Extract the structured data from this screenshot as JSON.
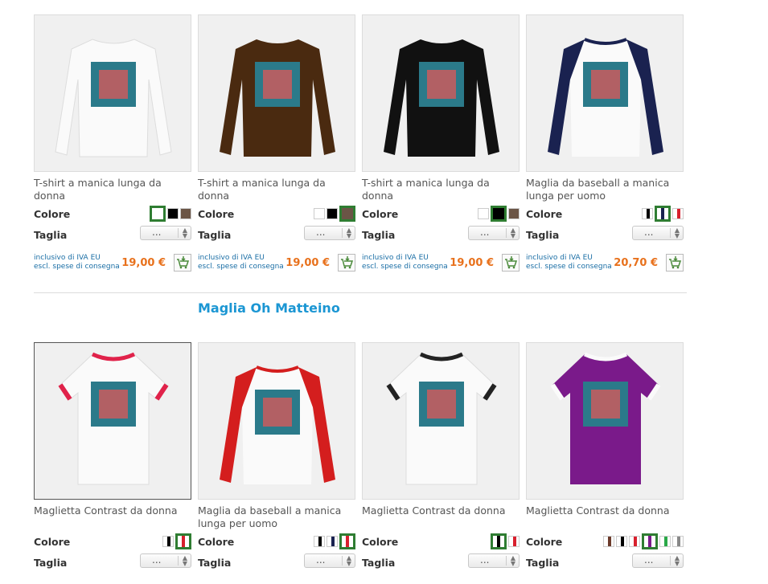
{
  "labels": {
    "colore": "Colore",
    "taglia": "Taglia",
    "vat_line1": "inclusivo di IVA EU",
    "vat_line2": "escl. spese di consegna"
  },
  "section_title": "Maglia Oh Matteino",
  "size_placeholder": "...",
  "products_row1": [
    {
      "name": "T-shirt a manica lunga da donna",
      "price": "19,00 €"
    },
    {
      "name": "T-shirt a manica lunga da donna",
      "price": "19,00 €"
    },
    {
      "name": "T-shirt a manica lunga da donna",
      "price": "19,00 €"
    },
    {
      "name": "Maglia da baseball a manica lunga per uomo",
      "price": "20,70 €"
    }
  ],
  "products_row2": [
    {
      "name": "Maglietta Contrast da donna"
    },
    {
      "name": "Maglia da baseball a manica lunga per uomo"
    },
    {
      "name": "Maglietta Contrast da donna"
    },
    {
      "name": "Maglietta Contrast da donna"
    }
  ],
  "colors": {
    "accent_price": "#e8711c",
    "section_title": "#1b96d3",
    "selected_border": "#2f7d32"
  },
  "icons": {
    "cart": "add-to-cart-icon"
  }
}
